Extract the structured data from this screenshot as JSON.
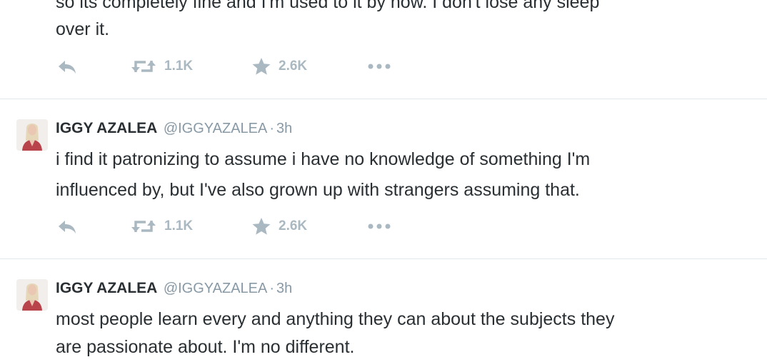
{
  "tweets": [
    {
      "lines": [
        "so its completely fine and I'm used to it by now. I don't lose any sleep",
        "over it."
      ],
      "actions": {
        "retweet_count": "1.1K",
        "favorite_count": "2.6K"
      }
    },
    {
      "author": {
        "name": "IGGY AZALEA",
        "handle": "@IGGYAZALEA",
        "time": "3h"
      },
      "lines": [
        "i find it patronizing to assume i have no knowledge of something I'm",
        "influenced by, but I've also grown up with strangers assuming that."
      ],
      "actions": {
        "retweet_count": "1.1K",
        "favorite_count": "2.6K"
      }
    },
    {
      "author": {
        "name": "IGGY AZALEA",
        "handle": "@IGGYAZALEA",
        "time": "3h"
      },
      "lines": [
        "most people learn every and anything they can about the subjects they",
        "are passionate about. I'm no different."
      ]
    }
  ],
  "separator": "·",
  "icons": {
    "reply": "reply-icon",
    "retweet": "retweet-icon",
    "favorite": "star-icon",
    "more": "more-icon"
  },
  "colors": {
    "text": "#292f33",
    "muted": "#8899a6",
    "action": "#aab8c2",
    "divider": "#e1e8ed"
  }
}
